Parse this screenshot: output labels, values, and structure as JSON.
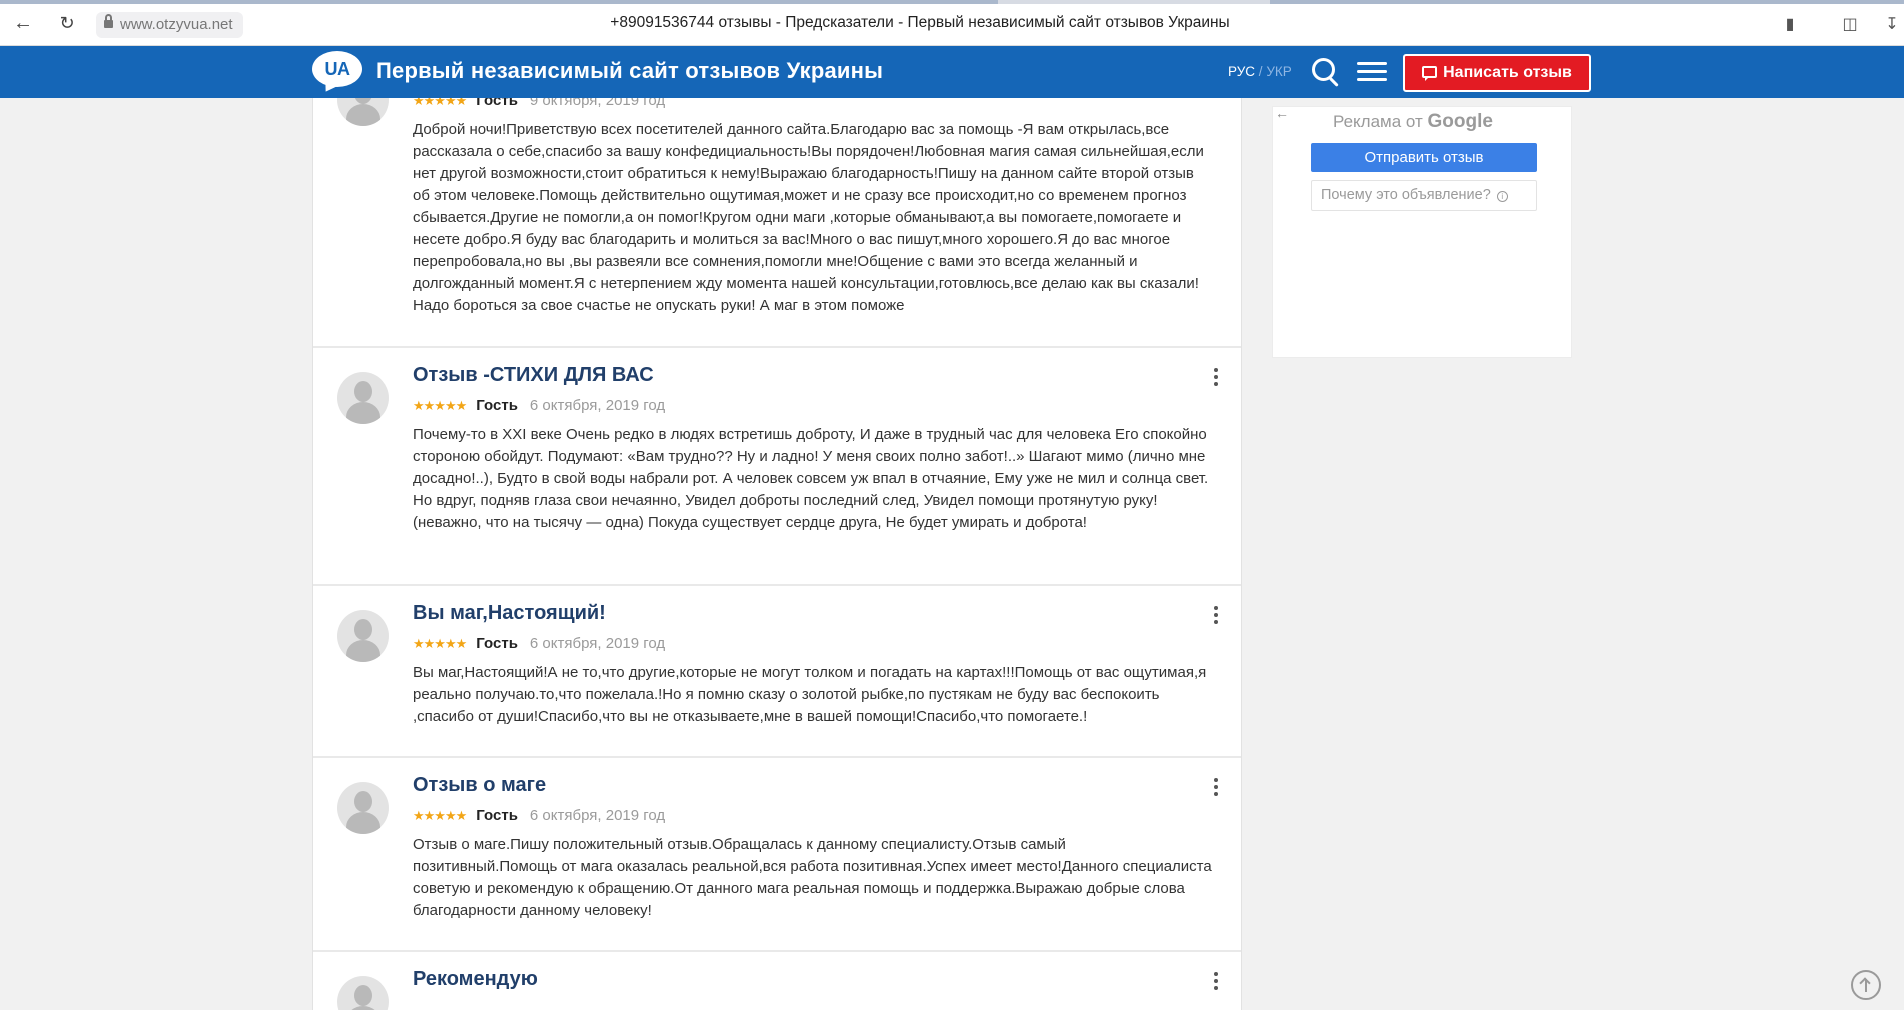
{
  "browser": {
    "url": "www.otzyvua.net",
    "tab_title": "+89091536744 отзывы - Предсказатели - Первый независимый сайт отзывов Украины"
  },
  "header": {
    "logo_text": "UA",
    "site_title": "Первый независимый сайт отзывов Украины",
    "lang_rus": "РУС",
    "lang_sep": " / ",
    "lang_ukr": "УКР",
    "write_review_label": "Написать отзыв"
  },
  "colors": {
    "header_blue": "#1566b7",
    "write_button_red": "#e31b23",
    "star_gold": "#f2a516",
    "title_navy": "#213f6a"
  },
  "reviews": [
    {
      "title": "",
      "stars": "★★★★★",
      "author": "Гость",
      "date": "9 октября, 2019 год",
      "text": "Доброй ночи!Приветствую всех посетителей данного сайта.Благодарю вас за помощь -Я вам открылась,все рассказала о себе,спасибо за вашу конфедициальность!Вы порядочен!Любовная магия самая сильнейшая,если нет другой возможности,стоит обратиться к нему!Выражаю благодарность!Пишу на данном сайте второй отзыв об этом человеке.Помощь действительно ощутимая,может и не сразу все происходит,но со временем прогноз сбывается.Другие не помогли,а он помог!Кругом одни маги ,которые обманывают,а вы помогаете,помогаете и несете добро.Я буду вас благодарить и молиться за вас!Много о вас пишут,много хорошего.Я до вас многое перепробовала,но вы ,вы развеяли все сомнения,помогли мне!Общение с вами это всегда желанный и долгожданный момент.Я с нетерпением жду момента нашей консультации,готовлюсь,все делаю как вы сказали!Надо бороться за свое счастье не опускать руки! А маг в этом поможе"
    },
    {
      "title": "Отзыв -СТИХИ ДЛЯ ВАС",
      "stars": "★★★★★",
      "author": "Гость",
      "date": "6 октября, 2019 год",
      "text": "Почему-то в XXI веке Очень редко в людях встретишь доброту, И даже в трудный час для человека Его спокойно стороною обойдут. Подумают: «Вам трудно?? Ну и ладно! У меня своих полно забот!..» Шагают мимо (лично мне досадно!..), Будто в свой воды набрали рот. А человек совсем уж впал в отчаяние, Ему уже не мил и солнца свет. Но вдруг, подняв глаза свои нечаянно, Увидел доброты последний след, Увидел помощи протянутую руку! (неважно, что на тысячу — одна) Покуда существует сердце друга, Не будет умирать и доброта!"
    },
    {
      "title": "Вы маг,Настоящий!",
      "stars": "★★★★★",
      "author": "Гость",
      "date": "6 октября, 2019 год",
      "text": "Вы маг,Настоящий!А не то,что другие,которые не могут толком и погадать на картах!!!Помощь от вас ощутимая,я реально получаю.то,что пожелала.!Но я помню сказу о золотой рыбке,по пустякам не буду вас беспокоить ,спасибо от души!Спасибо,что вы не отказываете,мне в вашей помощи!Спасибо,что помогаете.!"
    },
    {
      "title": "Отзыв о маге",
      "stars": "★★★★★",
      "author": "Гость",
      "date": "6 октября, 2019 год",
      "text": "Отзыв о маге.Пишу положительный отзыв.Обращалась к данному специалисту.Отзыв самый позитивный.Помощь от мага оказалась реальной,вся работа позитивная.Успех имеет место!Данного специалиста советую и рекомендую к обращению.От данного мага реальная помощь и поддержка.Выражаю добрые слова благодарности данному человеку!"
    },
    {
      "title": "Рекомендую",
      "stars": "",
      "author": "",
      "date": "",
      "text": ""
    }
  ],
  "ad": {
    "label_prefix": "Реклама от ",
    "label_brand": "Google",
    "send_feedback": "Отправить отзыв",
    "why_this_ad": "Почему это объявление?",
    "info_glyph": "i",
    "back_glyph": "←"
  }
}
